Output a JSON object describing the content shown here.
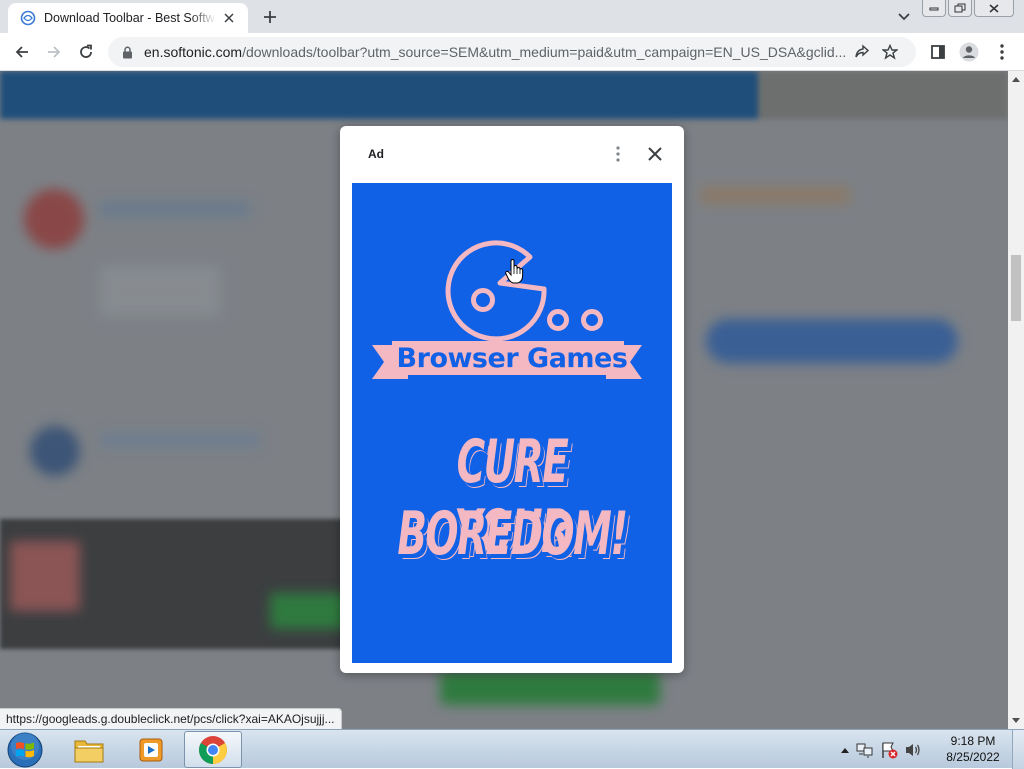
{
  "browser": {
    "tab": {
      "title": "Download Toolbar - Best Software & Apps"
    },
    "url": {
      "host": "en.softonic.com",
      "path": "/downloads/toolbar?utm_source=SEM&utm_medium=paid&utm_campaign=EN_US_DSA&gclid..."
    }
  },
  "ad": {
    "label": "Ad",
    "title": "Browser Games",
    "headline_line1": "CURE YOUR",
    "headline_line2": "BOREDOM!"
  },
  "status": {
    "link": "https://googleads.g.doubleclick.net/pcs/click?xai=AKAOjsujjj..."
  },
  "taskbar": {
    "time": "9:18 PM",
    "date": "8/25/2022"
  },
  "colors": {
    "ad_blue": "#1161e6",
    "ad_pink": "#f4b8c2",
    "chrome_frame": "#dee1e6"
  }
}
